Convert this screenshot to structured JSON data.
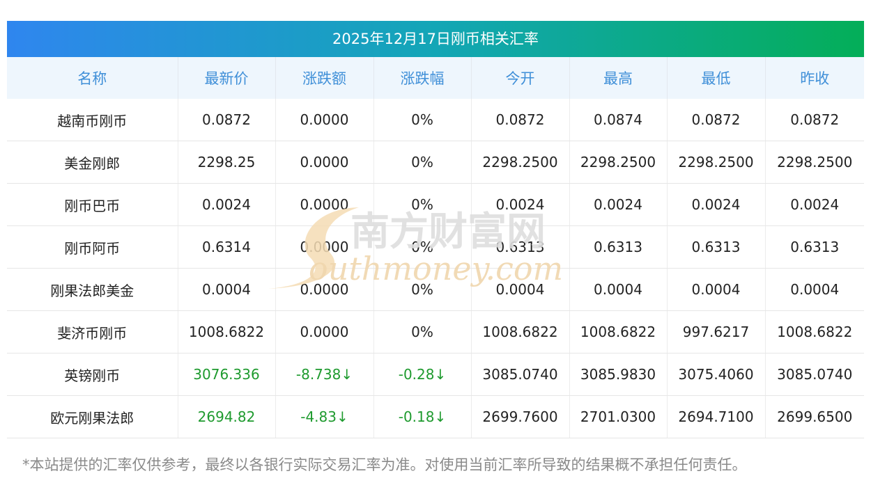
{
  "title": "2025年12月17日刚币相关汇率",
  "columns": [
    "名称",
    "最新价",
    "涨跌额",
    "涨跌幅",
    "今开",
    "最高",
    "最低",
    "昨收"
  ],
  "rows": [
    {
      "name": "越南币刚币",
      "latest": "0.0872",
      "change": "0.0000",
      "pct": "0%",
      "open": "0.0872",
      "high": "0.0874",
      "low": "0.0872",
      "prev": "0.0872",
      "trend": "flat"
    },
    {
      "name": "美金刚郎",
      "latest": "2298.25",
      "change": "0.0000",
      "pct": "0%",
      "open": "2298.2500",
      "high": "2298.2500",
      "low": "2298.2500",
      "prev": "2298.2500",
      "trend": "flat"
    },
    {
      "name": "刚币巴币",
      "latest": "0.0024",
      "change": "0.0000",
      "pct": "0%",
      "open": "0.0024",
      "high": "0.0024",
      "low": "0.0024",
      "prev": "0.0024",
      "trend": "flat"
    },
    {
      "name": "刚币阿币",
      "latest": "0.6314",
      "change": "0.0000",
      "pct": "0%",
      "open": "0.6313",
      "high": "0.6313",
      "low": "0.6313",
      "prev": "0.6313",
      "trend": "flat"
    },
    {
      "name": "刚果法郎美金",
      "latest": "0.0004",
      "change": "0.0000",
      "pct": "0%",
      "open": "0.0004",
      "high": "0.0004",
      "low": "0.0004",
      "prev": "0.0004",
      "trend": "flat"
    },
    {
      "name": "斐济币刚币",
      "latest": "1008.6822",
      "change": "0.0000",
      "pct": "0%",
      "open": "1008.6822",
      "high": "1008.6822",
      "low": "997.6217",
      "prev": "1008.6822",
      "trend": "flat"
    },
    {
      "name": "英镑刚币",
      "latest": "3076.336",
      "change": "-8.738↓",
      "pct": "-0.28↓",
      "open": "3085.0740",
      "high": "3085.9830",
      "low": "3075.4060",
      "prev": "3085.0740",
      "trend": "down"
    },
    {
      "name": "欧元刚果法郎",
      "latest": "2694.82",
      "change": "-4.83↓",
      "pct": "-0.18↓",
      "open": "2699.7600",
      "high": "2701.0300",
      "low": "2694.7100",
      "prev": "2699.6500",
      "trend": "down"
    }
  ],
  "watermark": {
    "cn": "南方财富网",
    "en": "outhmoney.com",
    "color": "#e9c890"
  },
  "colors": {
    "header_text": "#3f8fd8",
    "trend_text": "#1e9a2e"
  },
  "disclaimer": "*本站提供的汇率仅供参考，最终以各银行实际交易汇率为准。对使用当前汇率所导致的结果概不承担任何责任。"
}
